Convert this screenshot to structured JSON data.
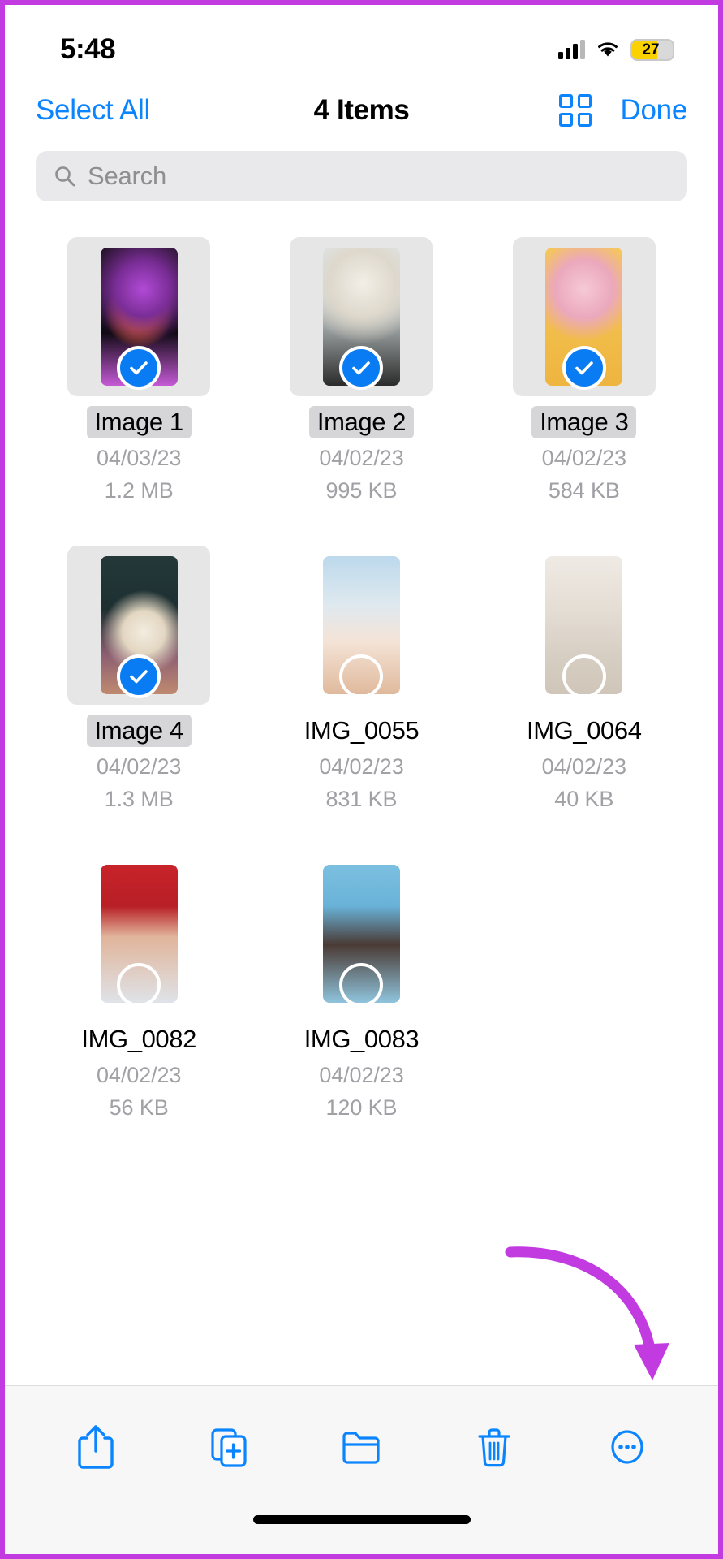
{
  "status_bar": {
    "time": "5:48",
    "battery_level": "27",
    "battery_percent": 27,
    "signal_icon": "cellular-signal-icon",
    "wifi_icon": "wifi-icon",
    "battery_icon": "battery-icon",
    "battery_color": "#fbd200"
  },
  "nav": {
    "select_all_label": "Select All",
    "title": "4 Items",
    "grid_icon": "grid-view-icon",
    "done_label": "Done",
    "accent_color": "#0a84ff"
  },
  "search": {
    "placeholder": "Search",
    "value": "",
    "icon": "search-icon"
  },
  "selection": {
    "selected_count": 4,
    "checkmark_color": "#0a7cf3",
    "selected_tile_background": "#e6e6e6"
  },
  "files": [
    {
      "name": "Image 1",
      "date": "04/03/23",
      "size": "1.2 MB",
      "selected": true,
      "art": "art-pumpkin"
    },
    {
      "name": "Image 2",
      "date": "04/02/23",
      "size": "995 KB",
      "selected": true,
      "art": "art-astronaut"
    },
    {
      "name": "Image 3",
      "date": "04/02/23",
      "size": "584 KB",
      "selected": true,
      "art": "art-icecream"
    },
    {
      "name": "Image 4",
      "date": "04/02/23",
      "size": "1.3 MB",
      "selected": true,
      "art": "art-flower"
    },
    {
      "name": "IMG_0055",
      "date": "04/02/23",
      "size": "831 KB",
      "selected": false,
      "art": "art-sunhand"
    },
    {
      "name": "IMG_0064",
      "date": "04/02/23",
      "size": "40 KB",
      "selected": false,
      "art": "art-window"
    },
    {
      "name": "IMG_0082",
      "date": "04/02/23",
      "size": "56 KB",
      "selected": false,
      "art": "art-redgirl"
    },
    {
      "name": "IMG_0083",
      "date": "04/02/23",
      "size": "120 KB",
      "selected": false,
      "art": "art-bluegirl"
    }
  ],
  "toolbar": {
    "accent_color": "#0a84ff",
    "buttons": [
      {
        "name": "share-icon",
        "label": "Share"
      },
      {
        "name": "duplicate-icon",
        "label": "Duplicate"
      },
      {
        "name": "folder-icon",
        "label": "Move to Folder"
      },
      {
        "name": "trash-icon",
        "label": "Delete"
      },
      {
        "name": "more-icon",
        "label": "More"
      }
    ]
  },
  "annotation": {
    "arrow_color": "#c23be0",
    "points_to": "more-icon",
    "border_color": "#c23be0"
  }
}
